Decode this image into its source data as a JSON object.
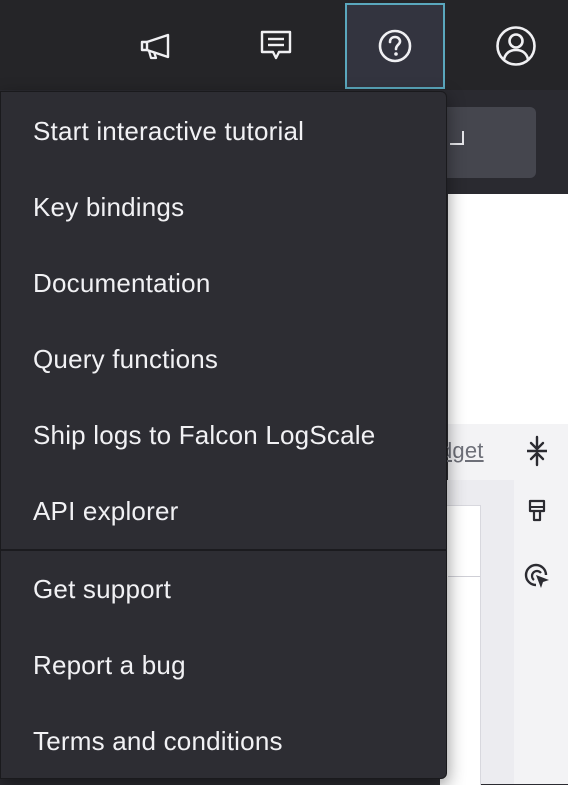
{
  "topbar": {
    "buttons": [
      {
        "name": "announcements-button",
        "icon": "megaphone-icon"
      },
      {
        "name": "feedback-button",
        "icon": "message-icon"
      },
      {
        "name": "help-button",
        "icon": "question-circle-icon",
        "active": true
      },
      {
        "name": "account-button",
        "icon": "user-circle-icon"
      }
    ]
  },
  "background": {
    "widget_link_fragment": "dget",
    "side_icons": [
      "collapse-arrows-icon",
      "paint-brush-icon",
      "cursor-target-icon"
    ]
  },
  "help_menu": {
    "items": [
      {
        "label": "Start interactive tutorial"
      },
      {
        "label": "Key bindings"
      },
      {
        "label": "Documentation"
      },
      {
        "label": "Query functions"
      },
      {
        "label": "Ship logs to Falcon LogScale"
      },
      {
        "label": "API explorer"
      },
      {
        "label": "Get support"
      },
      {
        "label": "Report a bug"
      },
      {
        "label": "Terms and conditions"
      }
    ]
  },
  "colors": {
    "topbar_bg": "#252528",
    "menu_bg": "#2d2d33",
    "active_border": "#5aa7bd",
    "menu_text": "#f1f1f4"
  }
}
